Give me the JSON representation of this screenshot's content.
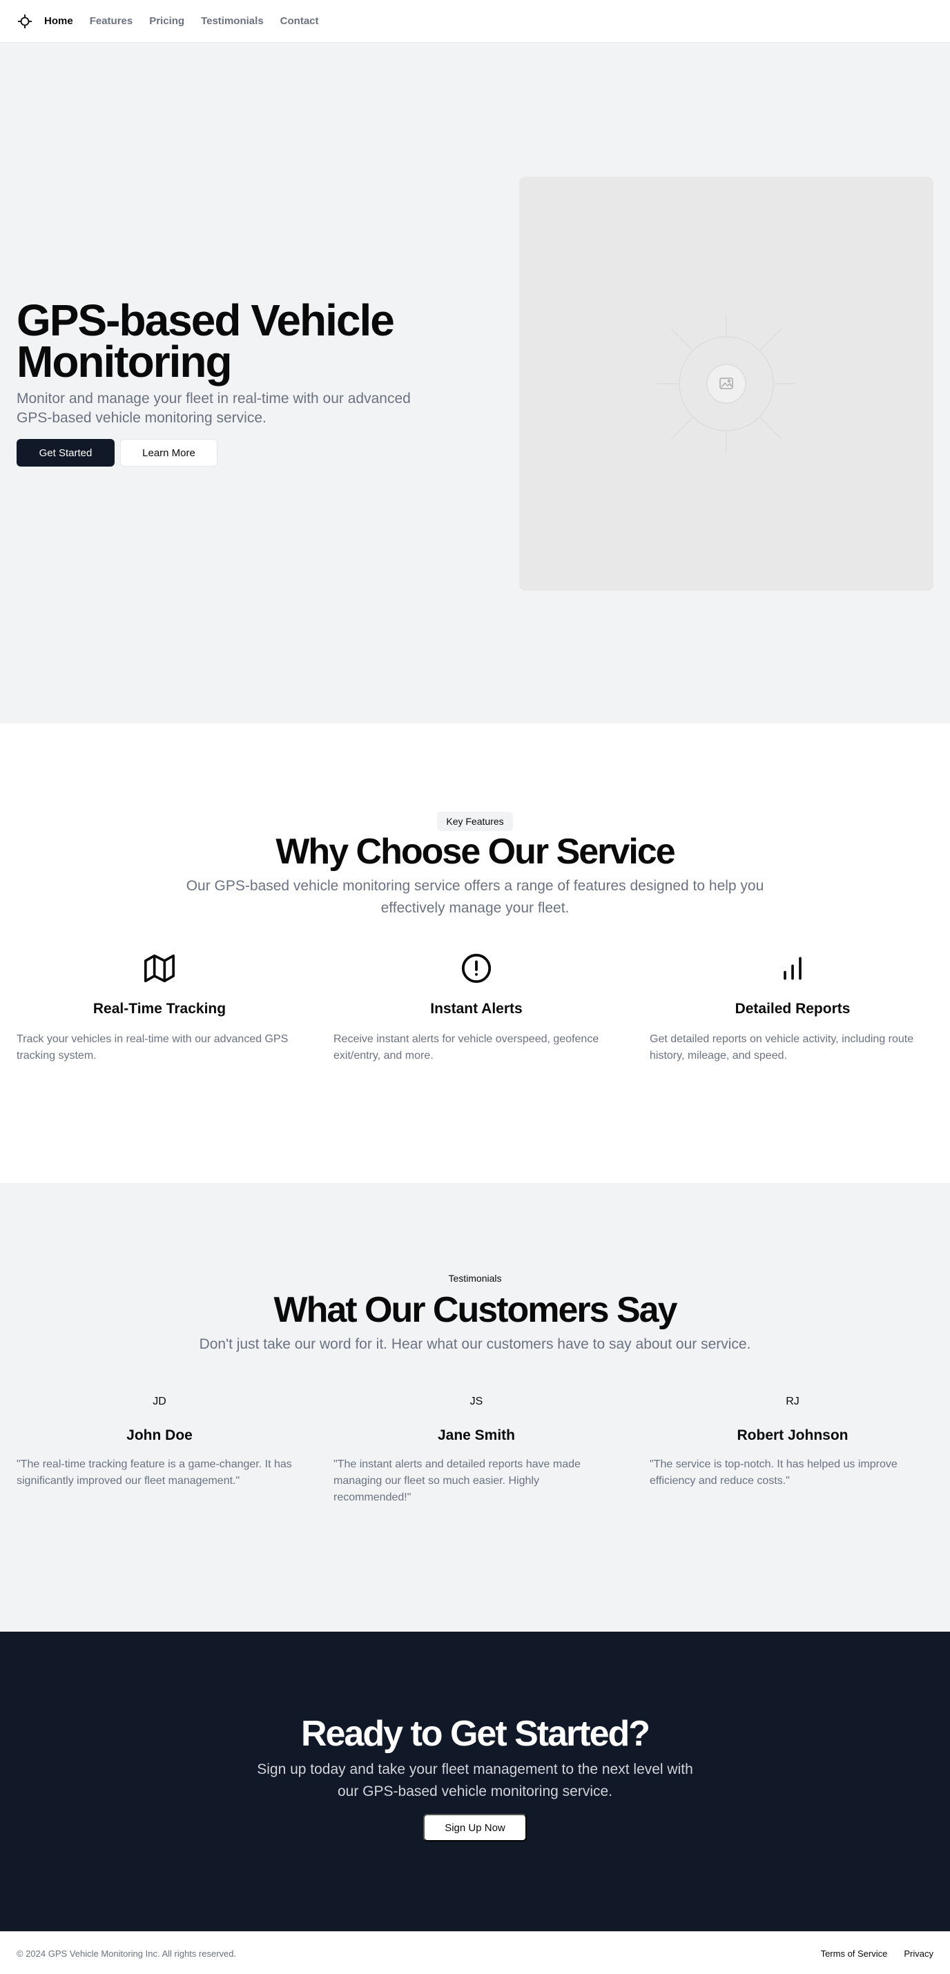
{
  "nav": {
    "items": [
      {
        "label": "Home",
        "active": true
      },
      {
        "label": "Features",
        "active": false
      },
      {
        "label": "Pricing",
        "active": false
      },
      {
        "label": "Testimonials",
        "active": false
      },
      {
        "label": "Contact",
        "active": false
      }
    ]
  },
  "hero": {
    "title": "GPS-based Vehicle Monitoring",
    "subtitle": "Monitor and manage your fleet in real-time with our advanced GPS-based vehicle monitoring service.",
    "primary_button": "Get Started",
    "secondary_button": "Learn More",
    "image_icon": "image-placeholder-icon"
  },
  "features": {
    "badge": "Key Features",
    "title": "Why Choose Our Service",
    "subtitle": "Our GPS-based vehicle monitoring service offers a range of features designed to help you effectively manage your fleet.",
    "items": [
      {
        "icon": "map-icon",
        "title": "Real-Time Tracking",
        "description": "Track your vehicles in real-time with our advanced GPS tracking system."
      },
      {
        "icon": "alert-circle-icon",
        "title": "Instant Alerts",
        "description": "Receive instant alerts for vehicle overspeed, geofence exit/entry, and more."
      },
      {
        "icon": "bar-chart-icon",
        "title": "Detailed Reports",
        "description": "Get detailed reports on vehicle activity, including route history, mileage, and speed."
      }
    ]
  },
  "testimonials": {
    "badge": "Testimonials",
    "title": "What Our Customers Say",
    "subtitle": "Don't just take our word for it. Hear what our customers have to say about our service.",
    "items": [
      {
        "initials": "JD",
        "name": "John Doe",
        "quote": "\"The real-time tracking feature is a game-changer. It has significantly improved our fleet management.\""
      },
      {
        "initials": "JS",
        "name": "Jane Smith",
        "quote": "\"The instant alerts and detailed reports have made managing our fleet so much easier. Highly recommended!\""
      },
      {
        "initials": "RJ",
        "name": "Robert Johnson",
        "quote": "\"The service is top-notch. It has helped us improve efficiency and reduce costs.\""
      }
    ]
  },
  "cta": {
    "title": "Ready to Get Started?",
    "subtitle": "Sign up today and take your fleet management to the next level with our GPS-based vehicle monitoring service.",
    "button": "Sign Up Now"
  },
  "footer": {
    "copyright": "© 2024 GPS Vehicle Monitoring Inc. All rights reserved.",
    "links": [
      "Terms of Service",
      "Privacy"
    ]
  },
  "colors": {
    "dark": "#111827",
    "muted_text": "#6b7280",
    "light_bg": "#f2f3f5"
  }
}
